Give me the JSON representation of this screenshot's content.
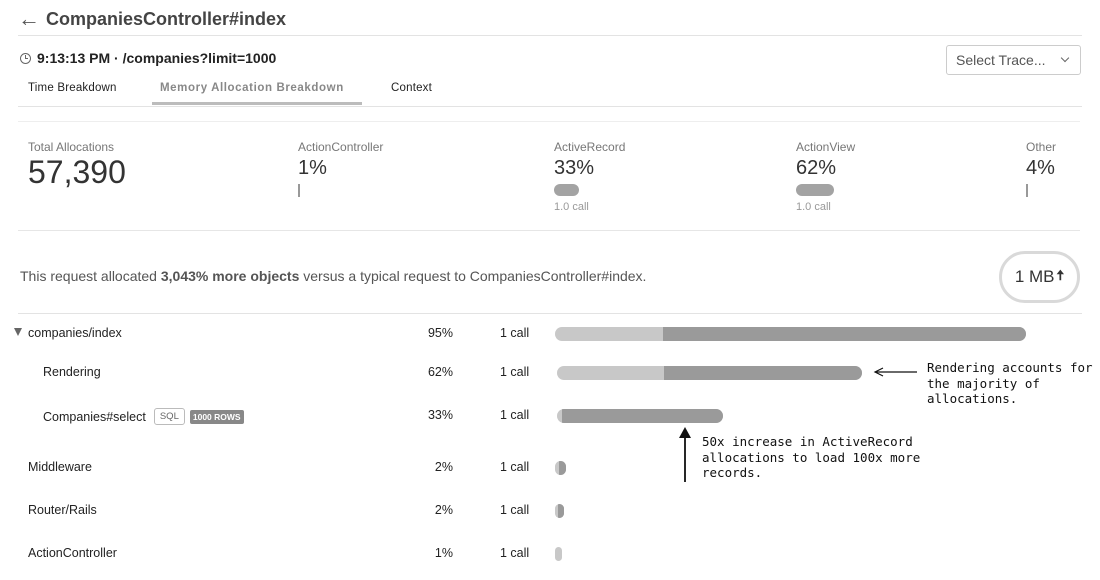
{
  "header": {
    "back_icon": "left-arrow-icon",
    "title": "CompaniesController#index"
  },
  "request": {
    "icon": "clock-icon",
    "info": "9:13:13 PM · /companies?limit=1000"
  },
  "trace_select": {
    "label": "Select Trace...",
    "icon": "chevron-down-icon"
  },
  "tabs": [
    {
      "label": "Time Breakdown",
      "active": false
    },
    {
      "label": "Memory Allocation Breakdown",
      "active": true
    },
    {
      "label": "Context",
      "active": false
    }
  ],
  "summary": {
    "total": {
      "label": "Total Allocations",
      "value": "57,390"
    },
    "breakdown": [
      {
        "label": "ActionController",
        "value": "1%",
        "calls": ""
      },
      {
        "label": "ActiveRecord",
        "value": "33%",
        "calls": "1.0 call"
      },
      {
        "label": "ActionView",
        "value": "62%",
        "calls": "1.0 call"
      },
      {
        "label": "Other",
        "value": "4%",
        "calls": ""
      }
    ]
  },
  "comparison": {
    "prefix": "This request allocated ",
    "highlight": "3,043% more objects",
    "suffix": " versus a typical request to CompaniesController#index."
  },
  "size_badge": {
    "label": "1 MB",
    "icon": "up-arrow-icon",
    "arrow": "🠅"
  },
  "rows": [
    {
      "name": "companies/index",
      "pct": "95%",
      "calls": "1 call",
      "expandable": true,
      "light_fraction": 0.23
    },
    {
      "name": "Rendering",
      "pct": "62%",
      "calls": "1 call",
      "expandable": false,
      "light_fraction": 0.35
    },
    {
      "name": "Companies#select",
      "pct": "33%",
      "calls": "1 call",
      "expandable": false,
      "light_fraction": 0.03,
      "badges": [
        "SQL",
        "1000 ROWS"
      ]
    },
    {
      "name": "Middleware",
      "pct": "2%",
      "calls": "1 call",
      "expandable": false,
      "light_fraction": 0.4
    },
    {
      "name": "Router/Rails",
      "pct": "2%",
      "calls": "1 call",
      "expandable": false,
      "light_fraction": 0.3
    },
    {
      "name": "ActionController",
      "pct": "1%",
      "calls": "1 call",
      "expandable": false,
      "light_fraction": 1.0
    }
  ],
  "annotations": [
    {
      "text": "Rendering accounts for\nthe majority of\nallocations."
    },
    {
      "text": "50x increase in ActiveRecord\nallocations to load 100x more\nrecords."
    }
  ]
}
